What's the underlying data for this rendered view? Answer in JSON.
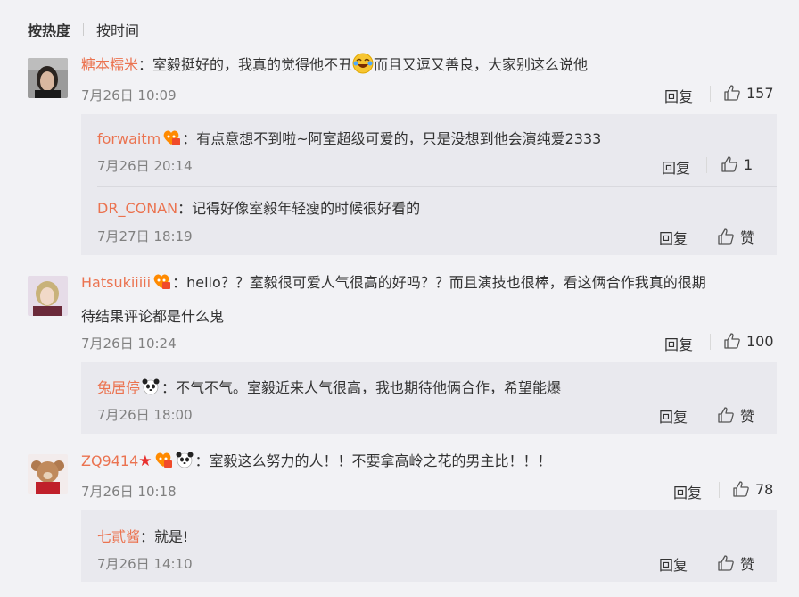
{
  "sort": {
    "hot": "按热度",
    "time": "按时间"
  },
  "labels": {
    "reply": "回复",
    "like_text": "赞"
  },
  "comments": [
    {
      "user": "糖本糯米",
      "text_before": "：室毅挺好的，我真的觉得他不丑",
      "text_after": "而且又逗又善良，大家别这么说他",
      "time": "7月26日 10:09",
      "likes": "157",
      "replies": [
        {
          "user": "forwaitm",
          "text": "：有点意想不到啦~阿室超级可爱的，只是没想到他会演纯爱2333",
          "time": "7月26日 20:14",
          "likes": "1"
        },
        {
          "user": "DR_CONAN",
          "text": "：记得好像室毅年轻瘦的时候很好看的",
          "time": "7月27日 18:19",
          "likes": "赞"
        }
      ]
    },
    {
      "user": "Hatsukiiiii",
      "text_line1": "：hello？？室毅很可爱人气很高的好吗？？而且演技也很棒，看这俩合作我真的很期",
      "text_line2": "待结果评论都是什么鬼",
      "time": "7月26日 10:24",
      "likes": "100",
      "replies": [
        {
          "user": "兔居停",
          "text": "：不气不气。室毅近来人气很高，我也期待他俩合作，希望能爆",
          "time": "7月26日 18:00",
          "likes": "赞"
        }
      ]
    },
    {
      "user": "ZQ9414",
      "text": "：室毅这么努力的人！！不要拿高岭之花的男主比！！！",
      "time": "7月26日 10:18",
      "likes": "78",
      "replies": [
        {
          "user": "七貳酱",
          "text": "：就是!",
          "time": "7月26日 14:10",
          "likes": "赞"
        }
      ]
    }
  ],
  "icons": [
    "thumbs-up-icon",
    "vip-badge-icon",
    "panda-icon",
    "star-icon",
    "laughing-emoji-icon"
  ],
  "colors": {
    "username": "#eb7350",
    "meta": "#808080",
    "background": "#f2f2f5",
    "reply_box": "#e9e9ee"
  }
}
